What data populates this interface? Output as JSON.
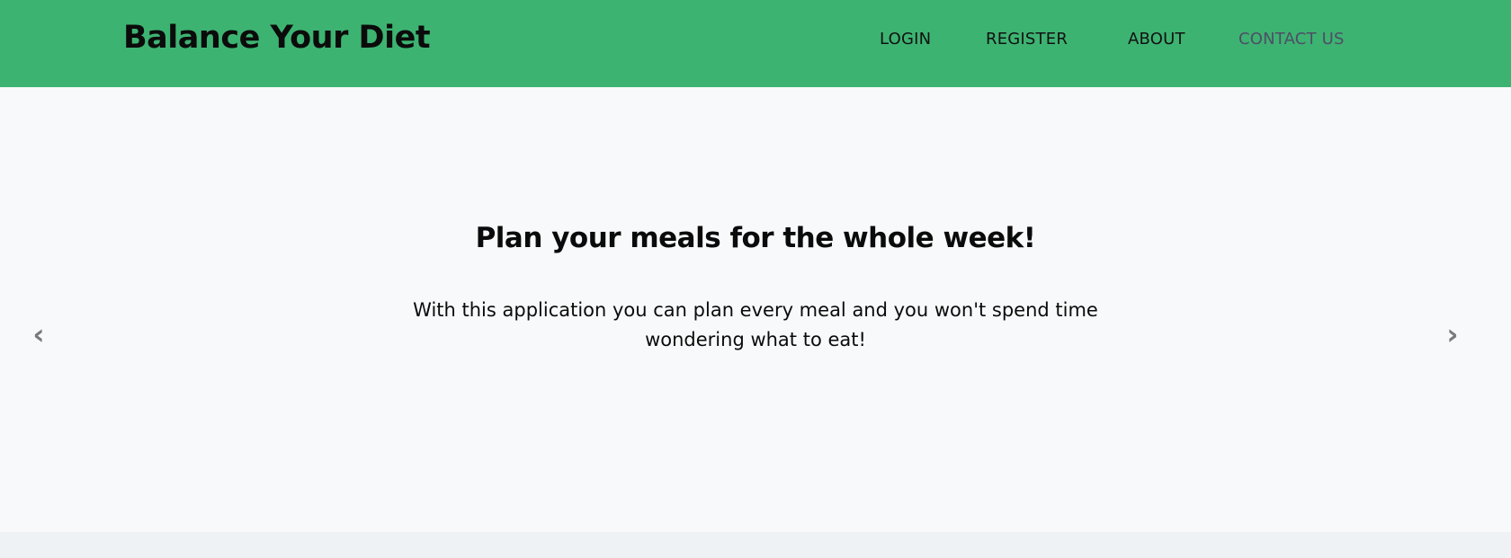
{
  "navbar": {
    "brand": "Balance Your Diet",
    "links": [
      {
        "label": "LOGIN"
      },
      {
        "label": "REGISTER"
      },
      {
        "label": "ABOUT"
      },
      {
        "label": "CONTACT US",
        "active": true
      }
    ]
  },
  "carousel": {
    "headline": "Plan your meals for the whole week!",
    "subtext": "With this application you can plan every meal and you won't spend time wondering what to eat!",
    "prev_icon": "‹",
    "next_icon": "›"
  },
  "colors": {
    "navbar_bg": "#3db372",
    "active_link": "#4e4e65",
    "carousel_bg": "#f8f9fa",
    "arrow": "#7a7a7a"
  }
}
